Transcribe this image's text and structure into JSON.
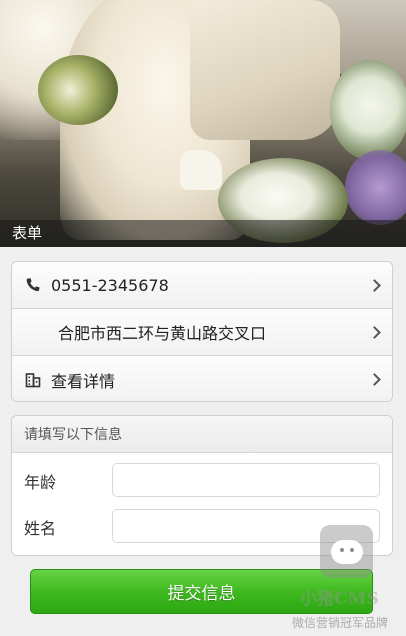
{
  "banner": {
    "caption": "表单"
  },
  "info_list": [
    {
      "icon": "phone-icon",
      "text": "0551-2345678"
    },
    {
      "icon": "",
      "text": "合肥市西二环与黄山路交叉口"
    },
    {
      "icon": "building-icon",
      "text": "查看详情"
    }
  ],
  "form": {
    "header": "请填写以下信息",
    "fields": [
      {
        "label": "年龄",
        "value": ""
      },
      {
        "label": "姓名",
        "value": ""
      }
    ],
    "submit_label": "提交信息"
  },
  "watermark": {
    "brand": "小猪CMS",
    "slogan": "微信营销冠军品牌"
  },
  "colors": {
    "submit_green": "#3fb91f",
    "caption_overlay": "#191919"
  }
}
